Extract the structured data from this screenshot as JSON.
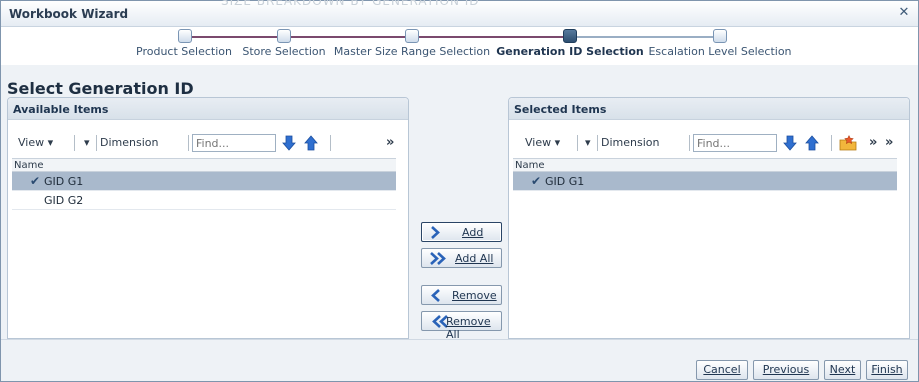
{
  "dialog": {
    "title": "Workbook Wizard",
    "background_text": "SIZE BREAKDOWN BY GENERATION ID",
    "close_glyph": "✕"
  },
  "train": {
    "steps": [
      {
        "label": "Product Selection",
        "state": "visited"
      },
      {
        "label": "Store Selection",
        "state": "visited"
      },
      {
        "label": "Master Size Range Selection",
        "state": "visited"
      },
      {
        "label": "Generation ID Selection",
        "state": "current"
      },
      {
        "label": "Escalation Level Selection",
        "state": "unvisited"
      }
    ]
  },
  "page_title": "Select Generation ID",
  "available": {
    "title": "Available Items",
    "view_label": "View",
    "dimension_label": "Dimension",
    "find_placeholder": "Find...",
    "more_glyph": "»",
    "column_header": "Name",
    "rows": [
      {
        "label": "GID G1",
        "selected": true
      },
      {
        "label": "GID G2",
        "selected": false
      }
    ]
  },
  "selected": {
    "title": "Selected Items",
    "view_label": "View",
    "dimension_label": "Dimension",
    "find_placeholder": "Find...",
    "more_glyph": "»",
    "column_header": "Name",
    "rows": [
      {
        "label": "GID G1",
        "selected": true
      }
    ]
  },
  "shuttle": {
    "add": "Add",
    "add_all": "Add All",
    "remove": "Remove",
    "remove_all": "Remove All"
  },
  "footer": {
    "cancel": "Cancel",
    "previous": "Previous",
    "next": "Next",
    "finish": "Finish"
  },
  "colors": {
    "accent": "#1f3550",
    "selected_row": "#a9b9cc",
    "train_done": "#7b4a6e",
    "arrow_blue": "#2f6fd0"
  }
}
